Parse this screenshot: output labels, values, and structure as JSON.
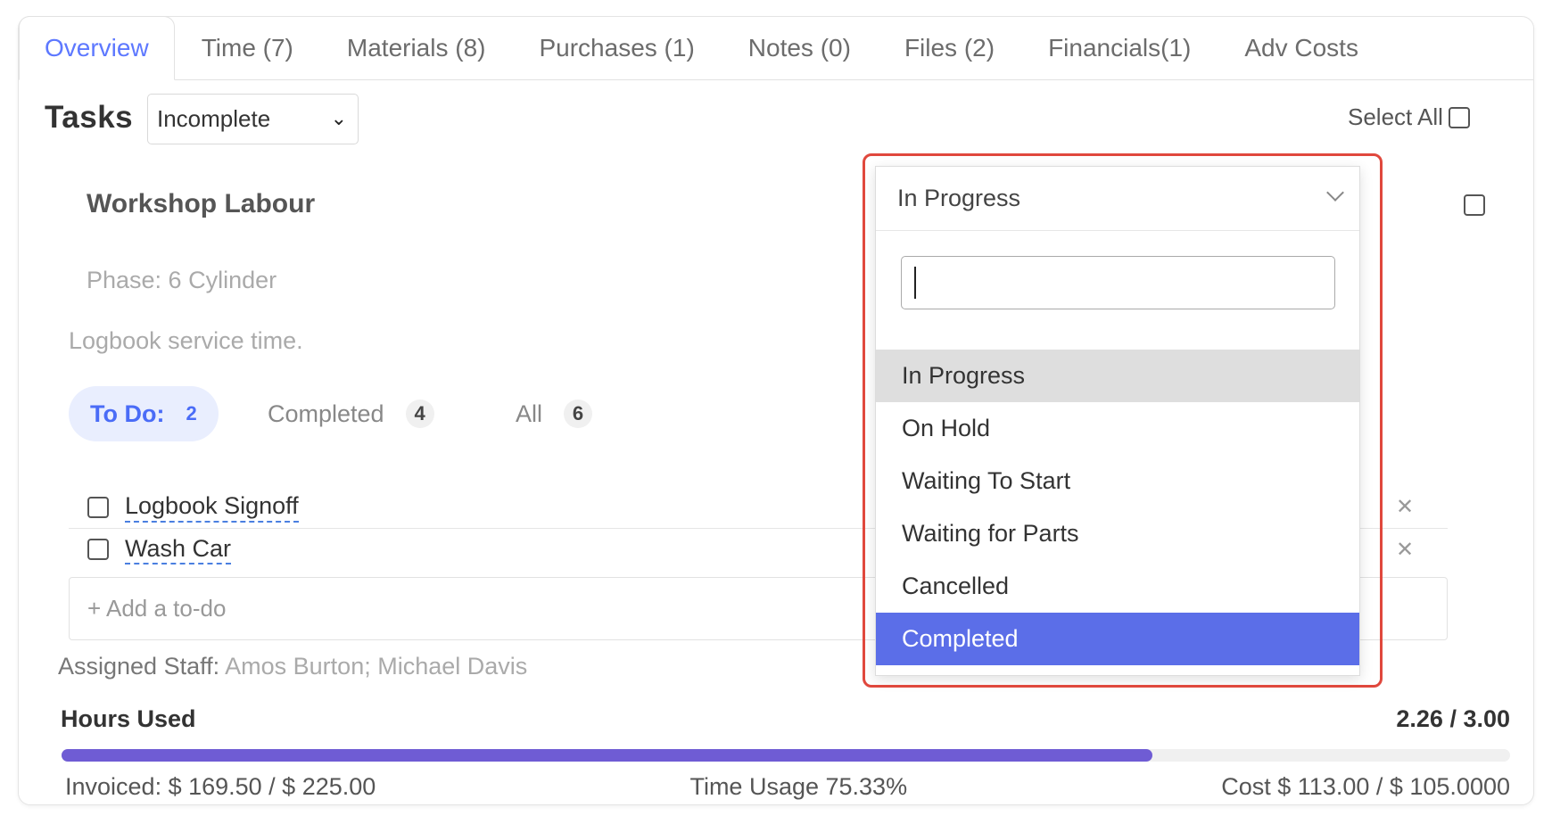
{
  "tabs": [
    {
      "label": "Overview",
      "active": true
    },
    {
      "label": "Time (7)"
    },
    {
      "label": "Materials (8)"
    },
    {
      "label": "Purchases (1)"
    },
    {
      "label": "Notes (0)"
    },
    {
      "label": "Files (2)"
    },
    {
      "label": "Financials(1)"
    },
    {
      "label": "Adv Costs"
    }
  ],
  "tasks": {
    "title": "Tasks",
    "filter_value": "Incomplete",
    "select_all_label": "Select All"
  },
  "task": {
    "title": "Workshop Labour",
    "phase": "Phase: 6 Cylinder",
    "description": "Logbook service time.",
    "filters": {
      "todo_label": "To Do:",
      "todo_count": "2",
      "completed_label": "Completed",
      "completed_count": "4",
      "all_label": "All",
      "all_count": "6"
    },
    "todos": [
      {
        "label": "Logbook Signoff"
      },
      {
        "label": "Wash Car"
      }
    ],
    "add_todo_placeholder": "+ Add a to-do",
    "assigned_label": "Assigned Staff:",
    "assigned_names": "Amos Burton; Michael Davis",
    "hours_label": "Hours Used",
    "hours_value": "2.26 / 3.00",
    "hours_fraction": 0.7533,
    "invoiced": "Invoiced: $ 169.50 / $ 225.00",
    "time_usage": "Time Usage 75.33%",
    "cost": "Cost $ 113.00 / $ 105.0000"
  },
  "status_dropdown": {
    "selected": "In Progress",
    "search_value": "",
    "options": [
      {
        "label": "In Progress",
        "state": "hover"
      },
      {
        "label": "On Hold",
        "state": ""
      },
      {
        "label": "Waiting To Start",
        "state": ""
      },
      {
        "label": "Waiting for Parts",
        "state": ""
      },
      {
        "label": "Cancelled",
        "state": ""
      },
      {
        "label": "Completed",
        "state": "active"
      }
    ]
  },
  "icons": {
    "remove": "close-icon",
    "chevron": "chevron-down-icon"
  },
  "colors": {
    "accent": "#5d78ff",
    "progress": "#6f5cd4",
    "highlight_border": "#e0483d",
    "option_active": "#5b6ee8"
  }
}
